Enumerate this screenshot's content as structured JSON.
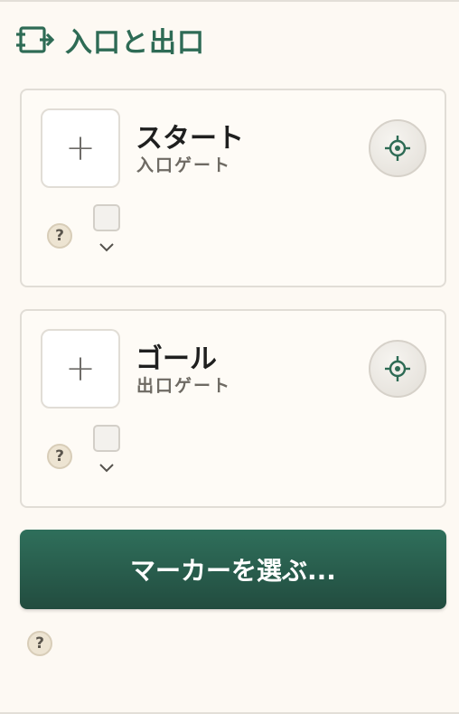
{
  "section": {
    "title": "入口と出口",
    "icon": "entry-exit-icon",
    "accent_color": "#2e6b55"
  },
  "gates": [
    {
      "title": "スタート",
      "subtitle": "入口ゲート",
      "add_label": "+",
      "help_label": "?",
      "checked": false
    },
    {
      "title": "ゴール",
      "subtitle": "出口ゲート",
      "add_label": "+",
      "help_label": "?",
      "checked": false
    }
  ],
  "select_button": {
    "label": "マーカーを選ぶ...",
    "color": "#2b5f4f"
  },
  "bottom_help": {
    "label": "?"
  }
}
